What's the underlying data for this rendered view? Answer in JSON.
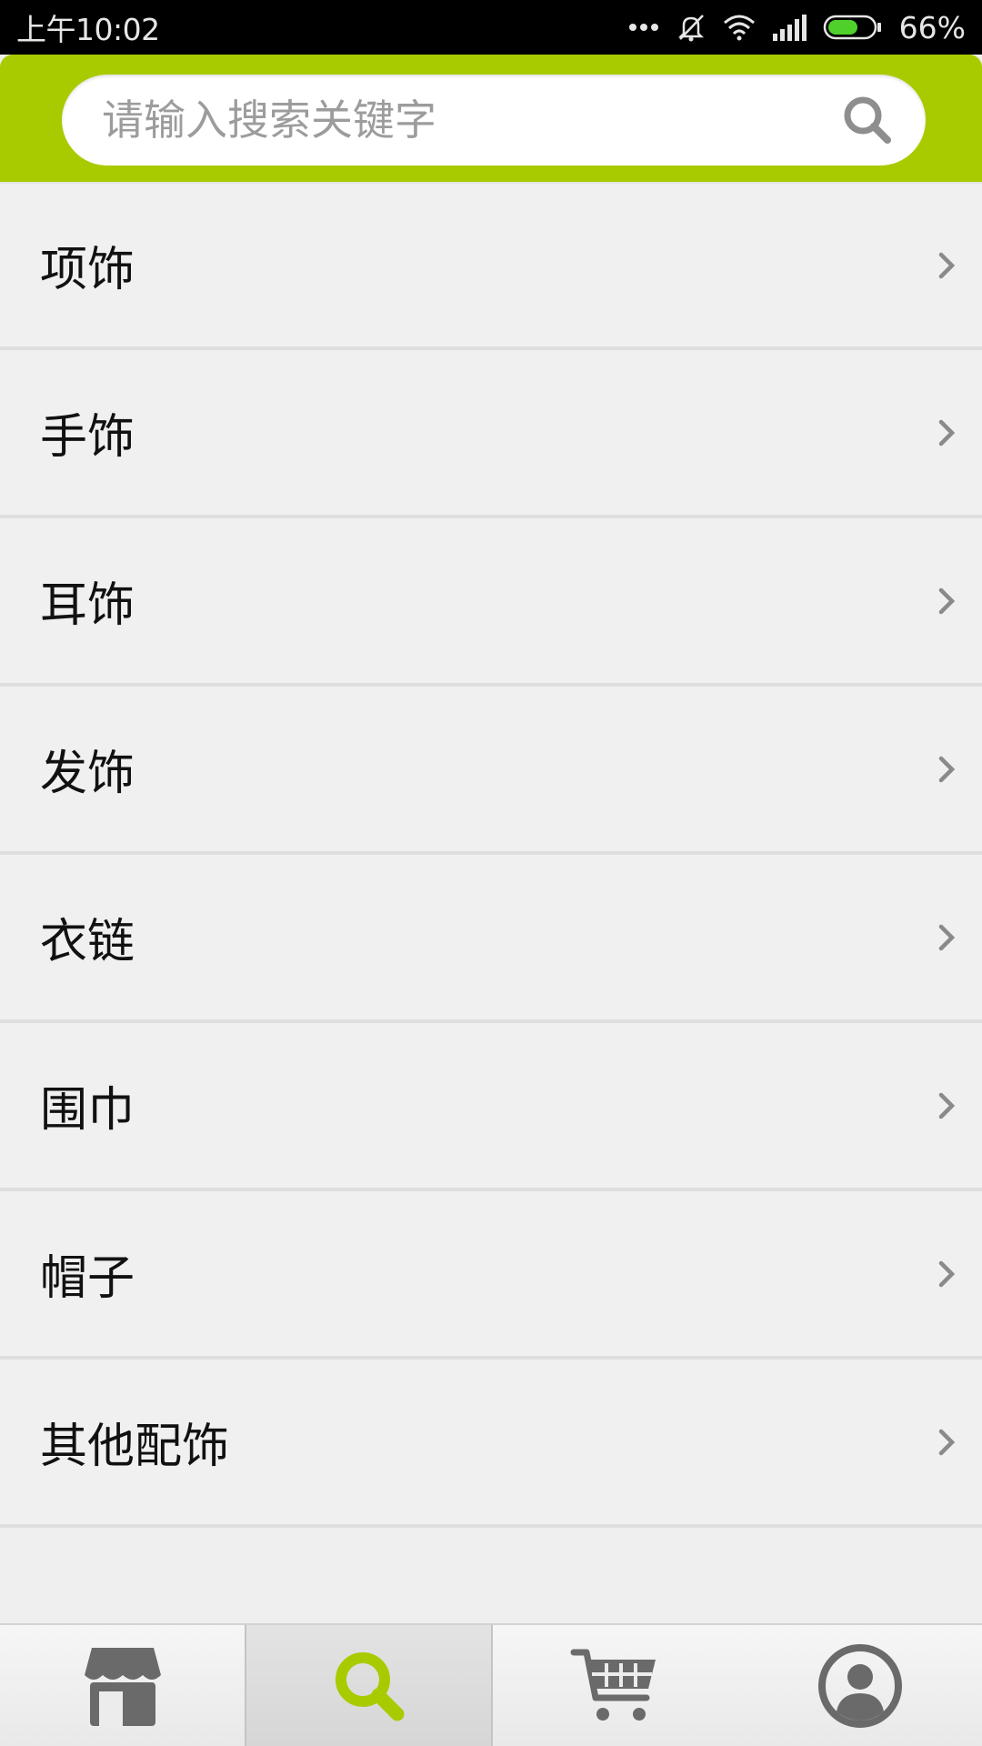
{
  "status_bar": {
    "time": "上午10:02",
    "battery_percent": "66%",
    "battery_level": 0.66,
    "icons": [
      "more-dots-icon",
      "mute-icon",
      "wifi-icon",
      "signal-icon",
      "battery-icon"
    ]
  },
  "search": {
    "placeholder": "请输入搜索关键字",
    "value": ""
  },
  "categories": [
    {
      "label": "项饰"
    },
    {
      "label": "手饰"
    },
    {
      "label": "耳饰"
    },
    {
      "label": "发饰"
    },
    {
      "label": "衣链"
    },
    {
      "label": "围巾"
    },
    {
      "label": "帽子"
    },
    {
      "label": "其他配饰"
    }
  ],
  "tab_bar": {
    "tabs": [
      {
        "icon": "store-icon",
        "active": false
      },
      {
        "icon": "search-icon",
        "active": true
      },
      {
        "icon": "cart-icon",
        "active": false
      },
      {
        "icon": "user-icon",
        "active": false
      }
    ]
  },
  "colors": {
    "accent": "#a8cb00",
    "list_background": "#f0f0f0",
    "icon_gray": "#666666"
  }
}
